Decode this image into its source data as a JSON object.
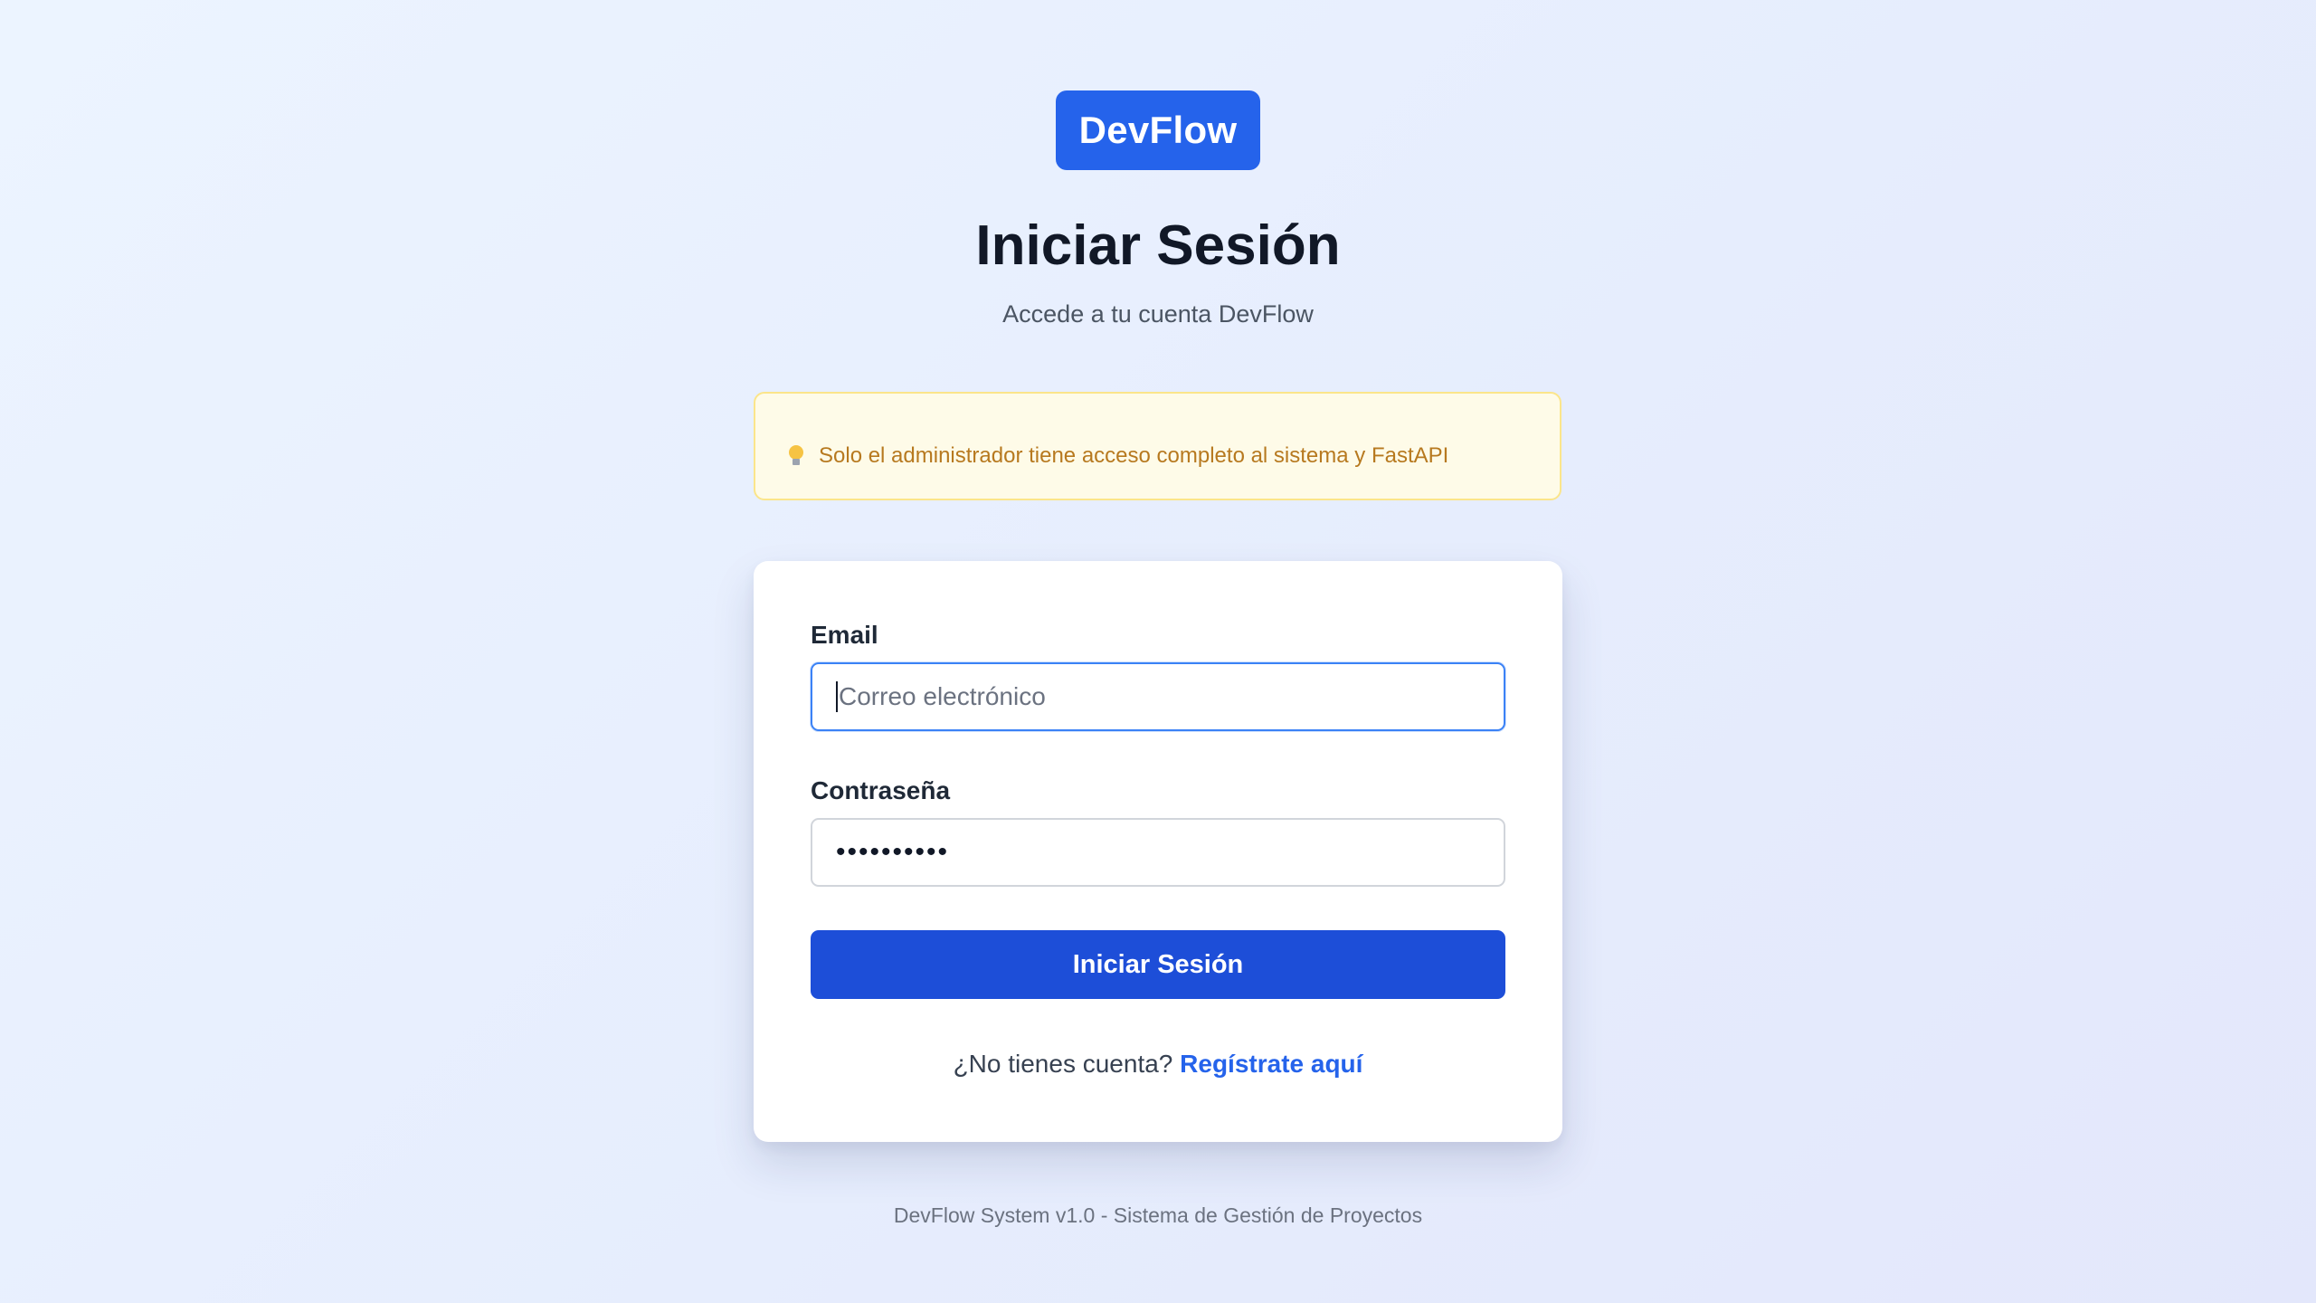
{
  "brand": {
    "logo_text": "DevFlow",
    "accent_color": "#2563eb"
  },
  "header": {
    "title": "Iniciar Sesión",
    "subtitle": "Accede a tu cuenta DevFlow"
  },
  "notice": {
    "icon": "lightbulb-icon",
    "text": "Solo el administrador tiene acceso completo al sistema y FastAPI"
  },
  "form": {
    "email_label": "Email",
    "email_placeholder": "Correo electrónico",
    "email_value": "",
    "password_label": "Contraseña",
    "password_value": "••••••••••",
    "submit_label": "Iniciar Sesión",
    "signup_prompt": "¿No tienes cuenta?",
    "signup_link": "Regístrate aquí"
  },
  "footer": {
    "text": "DevFlow System v1.0 - Sistema de Gestión de Proyectos"
  }
}
